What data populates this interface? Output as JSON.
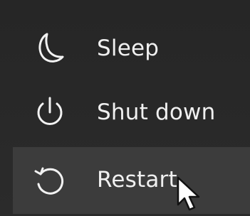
{
  "power_menu": {
    "items": [
      {
        "label": "Sleep",
        "icon": "moon-icon"
      },
      {
        "label": "Shut down",
        "icon": "power-icon"
      },
      {
        "label": "Restart",
        "icon": "restart-icon",
        "highlighted": true
      }
    ]
  },
  "colors": {
    "background": "#2b2b2b",
    "highlight": "#3c3c3c",
    "text": "#f0f0f0"
  }
}
